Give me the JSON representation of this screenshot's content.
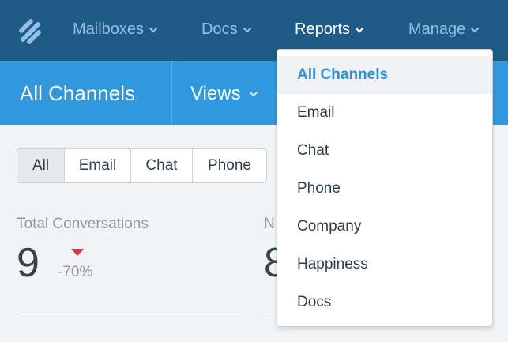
{
  "colors": {
    "nav_bg": "#1f5b87",
    "subheader_bg": "#3198dd",
    "nav_inactive": "#93c0e6",
    "accent": "#2f8fd8",
    "negative": "#e0323a"
  },
  "nav": {
    "logo_icon": "helpscout-logo",
    "items": [
      {
        "label": "Mailboxes",
        "icon": "chevron-down-icon"
      },
      {
        "label": "Docs",
        "icon": "chevron-down-icon"
      },
      {
        "label": "Reports",
        "icon": "chevron-down-icon",
        "active": true
      },
      {
        "label": "Manage",
        "icon": "chevron-down-icon"
      }
    ]
  },
  "subheader": {
    "title": "All Channels",
    "views_label": "Views"
  },
  "filters": {
    "options": [
      "All",
      "Email",
      "Chat",
      "Phone"
    ],
    "selected": "All"
  },
  "stats": {
    "total_conversations": {
      "label": "Total Conversations",
      "value": "9",
      "delta": "-70%",
      "trend": "down"
    },
    "second": {
      "label": "N",
      "value": "8"
    }
  },
  "reports_menu": {
    "items": [
      {
        "label": "All Channels",
        "active": true
      },
      {
        "label": "Email"
      },
      {
        "label": "Chat"
      },
      {
        "label": "Phone"
      },
      {
        "label": "Company"
      },
      {
        "label": "Happiness"
      },
      {
        "label": "Docs"
      }
    ]
  }
}
